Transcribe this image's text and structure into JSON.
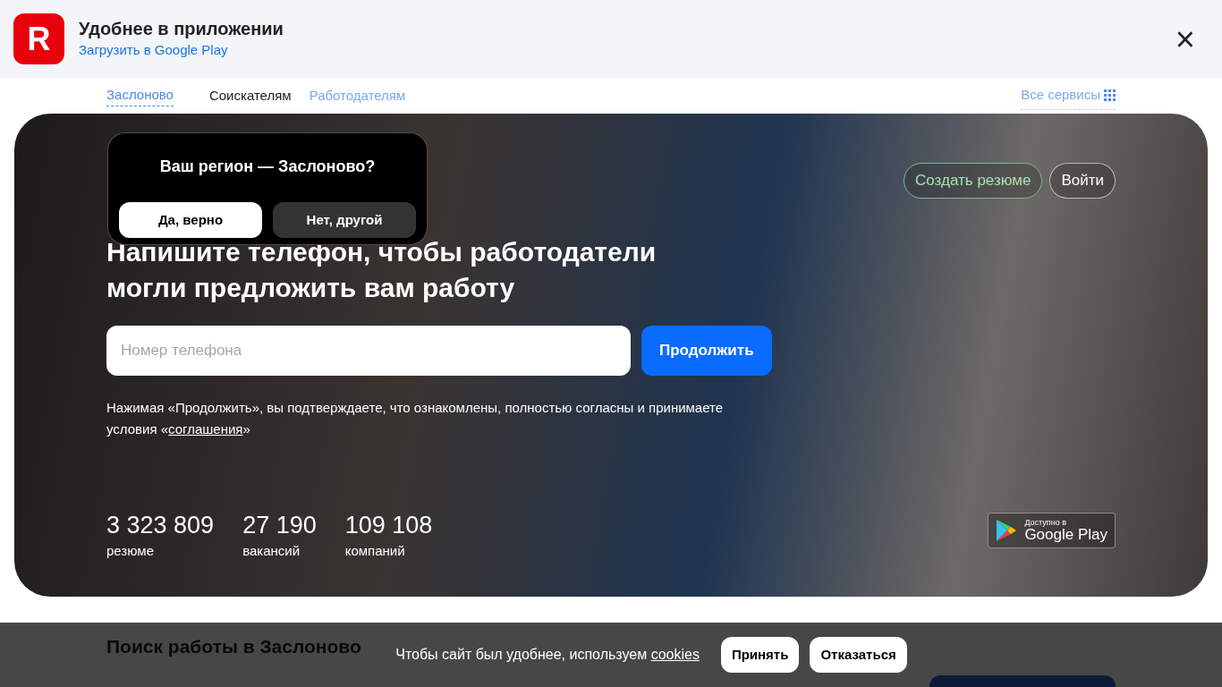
{
  "app_banner": {
    "logo": "R",
    "title": "Удобнее в приложении",
    "link": "Загрузить в Google Play",
    "close": "×"
  },
  "nav": {
    "region": "Заслоново",
    "items": [
      {
        "label": "Соискателям",
        "selected": true
      },
      {
        "label": "Работодателям",
        "selected": false
      }
    ],
    "all_services": "Все сервисы"
  },
  "region_popup": {
    "question": "Ваш регион — Заслоново?",
    "confirm": "Да, верно",
    "decline": "Нет, другой"
  },
  "hero": {
    "buttons": [
      {
        "label": "Создать резюме",
        "kind": "accent"
      },
      {
        "label": "Войти",
        "kind": "plain"
      }
    ],
    "heading": "Напишите телефон, чтобы работодатели могли предложить вам работу",
    "phone_field": {
      "placeholder": "Номер телефона"
    },
    "continue": "Продолжить",
    "consent": "Нажимая «Продолжить», вы подтверждаете, что ознакомлены, полностью согласны и принимаете условия «",
    "consent_link": "соглашения",
    "consent_end": "»",
    "stats": [
      {
        "value": "3 323 809",
        "label": "резюме"
      },
      {
        "value": "27 190",
        "label": "вакансий"
      },
      {
        "value": "109 108",
        "label": "компаний"
      }
    ],
    "store_badge": {
      "small": "Доступно в",
      "big": "Google Play"
    }
  },
  "section_heading": "Поиск работы в Заслоново",
  "cookie_bar": {
    "text": "Чтобы сайт был удобнее, используем ",
    "link": "cookies",
    "accept": "Принять",
    "decline": "Отказаться"
  }
}
